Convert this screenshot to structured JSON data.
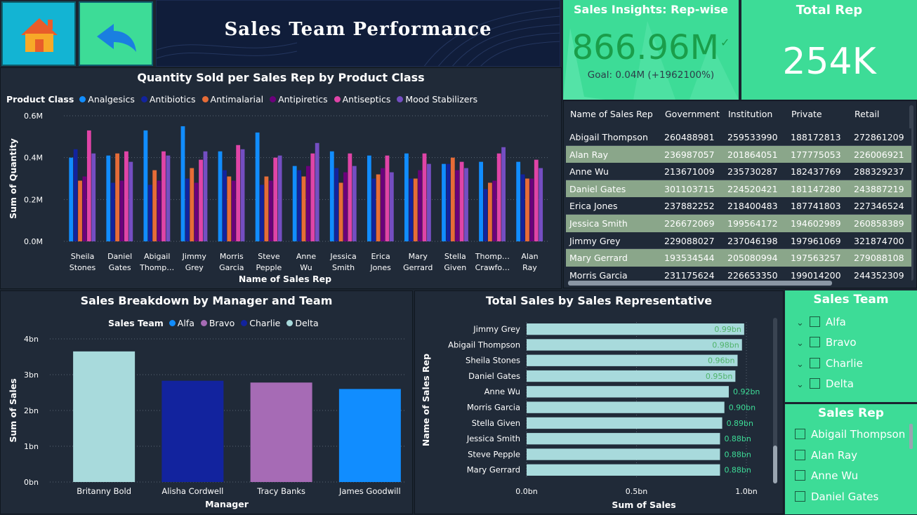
{
  "header": {
    "title": "Sales Team Performance",
    "home_icon": "home-icon",
    "back_icon": "back-arrow-icon"
  },
  "kpi": {
    "title": "Sales Insights: Rep-wise",
    "value": "866.96M",
    "check": "✓",
    "goal": "Goal: 0.04M (+1962100%)"
  },
  "total_rep": {
    "title": "Total Rep",
    "value": "254K"
  },
  "table": {
    "columns": [
      "Name of Sales Rep",
      "Government",
      "Institution",
      "Private",
      "Retail"
    ],
    "rows": [
      [
        "Abigail Thompson",
        "260488981",
        "259533990",
        "188172813",
        "272861209"
      ],
      [
        "Alan Ray",
        "236987057",
        "201864051",
        "177775053",
        "226006921"
      ],
      [
        "Anne Wu",
        "213671009",
        "235730287",
        "182437769",
        "288329237"
      ],
      [
        "Daniel Gates",
        "301103715",
        "224520421",
        "181147280",
        "243887219"
      ],
      [
        "Erica Jones",
        "237882252",
        "218400483",
        "187741803",
        "227346524"
      ],
      [
        "Jessica Smith",
        "226672069",
        "199564172",
        "194602989",
        "260858389"
      ],
      [
        "Jimmy Grey",
        "229088027",
        "237046198",
        "197961069",
        "321874700"
      ],
      [
        "Mary Gerrard",
        "193534544",
        "205080994",
        "197563257",
        "279088108"
      ],
      [
        "Morris Garcia",
        "231175624",
        "226653350",
        "199014200",
        "244352309"
      ]
    ]
  },
  "colors": {
    "Analgesics": "#118dff",
    "Antibiotics": "#12239e",
    "Antimalarial": "#e66c37",
    "Antipiretics": "#6b007b",
    "Antiseptics": "#e044a7",
    "Mood Stabilizers": "#744ec2",
    "Alfa": "#118dff",
    "Bravo": "#a66bb5",
    "Charlie": "#12239e",
    "Delta": "#a8dadc",
    "bar_h": "#a8dadc",
    "accent": "#3ddc97"
  },
  "chart_data": [
    {
      "type": "bar",
      "title": "Quantity Sold per Sales Rep by Product Class",
      "legend_title": "Product Class",
      "xlabel": "Name of Sales Rep",
      "ylabel": "Sum of Quantity",
      "yticks": [
        "0.0M",
        "0.2M",
        "0.4M",
        "0.6M"
      ],
      "ylim": [
        0,
        0.6
      ],
      "categories": [
        "Sheila Stones",
        "Daniel Gates",
        "Abigail Thomp…",
        "Jimmy Grey",
        "Morris Garcia",
        "Steve Pepple",
        "Anne Wu",
        "Jessica Smith",
        "Erica Jones",
        "Mary Gerrard",
        "Stella Given",
        "Thomp… Crawfo…",
        "Alan Ray"
      ],
      "series": [
        {
          "name": "Analgesics",
          "values": [
            0.4,
            0.41,
            0.53,
            0.55,
            0.43,
            0.52,
            0.36,
            0.43,
            0.41,
            0.42,
            0.37,
            0.38,
            0.38
          ]
        },
        {
          "name": "Antibiotics",
          "values": [
            0.44,
            0.28,
            0.27,
            0.3,
            0.34,
            0.27,
            0.34,
            0.35,
            0.3,
            0.3,
            0.37,
            0.25,
            0.32
          ]
        },
        {
          "name": "Antimalarial",
          "values": [
            0.29,
            0.42,
            0.34,
            0.35,
            0.31,
            0.31,
            0.31,
            0.28,
            0.32,
            0.3,
            0.4,
            0.28,
            0.3
          ]
        },
        {
          "name": "Antipiretics",
          "values": [
            0.31,
            0.29,
            0.29,
            0.28,
            0.29,
            0.29,
            0.36,
            0.33,
            0.35,
            0.34,
            0.34,
            0.29,
            0.3
          ]
        },
        {
          "name": "Antiseptics",
          "values": [
            0.53,
            0.43,
            0.43,
            0.39,
            0.46,
            0.4,
            0.42,
            0.42,
            0.41,
            0.42,
            0.38,
            0.42,
            0.39
          ]
        },
        {
          "name": "Mood Stabilizers",
          "values": [
            0.42,
            0.38,
            0.41,
            0.43,
            0.44,
            0.41,
            0.47,
            0.36,
            0.33,
            0.37,
            0.35,
            0.45,
            0.35
          ]
        }
      ]
    },
    {
      "type": "bar",
      "title": "Sales Breakdown by Manager and Team",
      "legend_title": "Sales Team",
      "xlabel": "Manager",
      "ylabel": "Sum of Sales",
      "yticks": [
        "0bn",
        "1bn",
        "2bn",
        "3bn",
        "4bn"
      ],
      "ylim": [
        0,
        4
      ],
      "categories": [
        "Britanny Bold",
        "Alisha Cordwell",
        "Tracy Banks",
        "James Goodwill"
      ],
      "values": [
        3.65,
        2.83,
        2.78,
        2.6
      ],
      "teams": [
        "Delta",
        "Charlie",
        "Bravo",
        "Alfa"
      ]
    },
    {
      "type": "bar",
      "orientation": "horizontal",
      "title": "Total Sales by Sales Representative",
      "xlabel": "Sum of Sales",
      "ylabel": "Name of Sales Rep",
      "xticks": [
        "0.0bn",
        "0.5bn",
        "1.0bn"
      ],
      "xlim": [
        0,
        1.0
      ],
      "categories": [
        "Jimmy Grey",
        "Abigail Thompson",
        "Sheila Stones",
        "Daniel Gates",
        "Anne Wu",
        "Morris Garcia",
        "Stella Given",
        "Jessica Smith",
        "Steve Pepple",
        "Mary Gerrard"
      ],
      "values": [
        0.99,
        0.98,
        0.96,
        0.95,
        0.92,
        0.9,
        0.89,
        0.88,
        0.88,
        0.88
      ],
      "labels": [
        "0.99bn",
        "0.98bn",
        "0.96bn",
        "0.95bn",
        "0.92bn",
        "0.90bn",
        "0.89bn",
        "0.88bn",
        "0.88bn",
        "0.88bn"
      ]
    }
  ],
  "slicer_team": {
    "title": "Sales Team",
    "items": [
      "Alfa",
      "Bravo",
      "Charlie",
      "Delta"
    ]
  },
  "slicer_rep": {
    "title": "Sales Rep",
    "items": [
      "Abigail Thompson",
      "Alan Ray",
      "Anne Wu",
      "Daniel Gates"
    ]
  }
}
